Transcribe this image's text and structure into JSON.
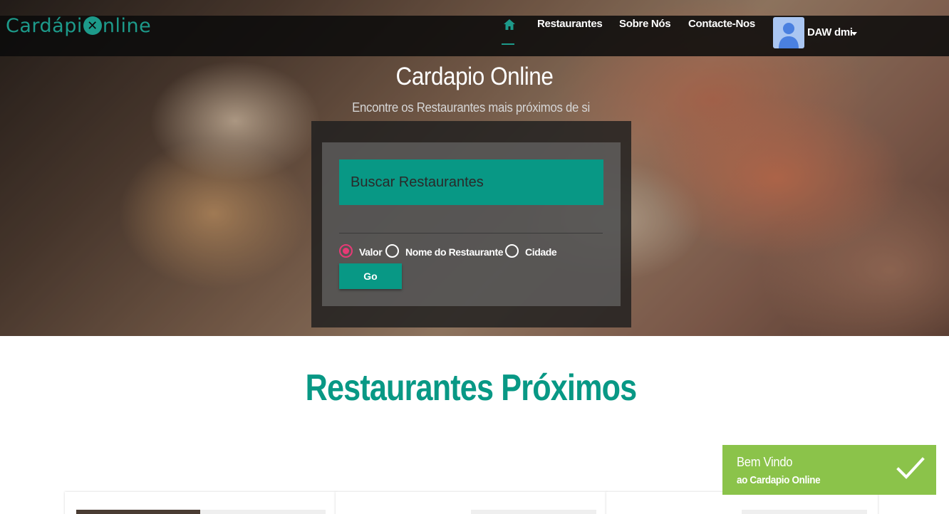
{
  "header": {
    "logo_text_left": "Cardápi",
    "logo_mark": "✕",
    "logo_text_right": "nline",
    "nav": {
      "home_icon": "home-icon",
      "items": [
        {
          "label": "Restaurantes"
        },
        {
          "label": "Sobre Nós"
        },
        {
          "label": "Contacte-Nos"
        }
      ]
    },
    "user": {
      "name": "DAW dmi",
      "avatar_icon": "user-avatar-icon"
    }
  },
  "hero": {
    "title": "Cardapio Online",
    "subtitle": "Encontre os Restaurantes mais próximos de si"
  },
  "search": {
    "placeholder": "Buscar Restaurantes",
    "value": "",
    "options": [
      {
        "label": "Valor",
        "checked": true
      },
      {
        "label": "Nome do Restaurante",
        "checked": false
      },
      {
        "label": "Cidade",
        "checked": false
      }
    ],
    "go_label": "Go"
  },
  "section": {
    "title": "Restaurantes Próximos"
  },
  "toast": {
    "title": "Bem Vindo",
    "message": "ao Cardapio Online",
    "icon": "check-icon"
  },
  "colors": {
    "accent": "#089885",
    "toast": "#8bc34a",
    "radio_selected": "#e83a76"
  }
}
